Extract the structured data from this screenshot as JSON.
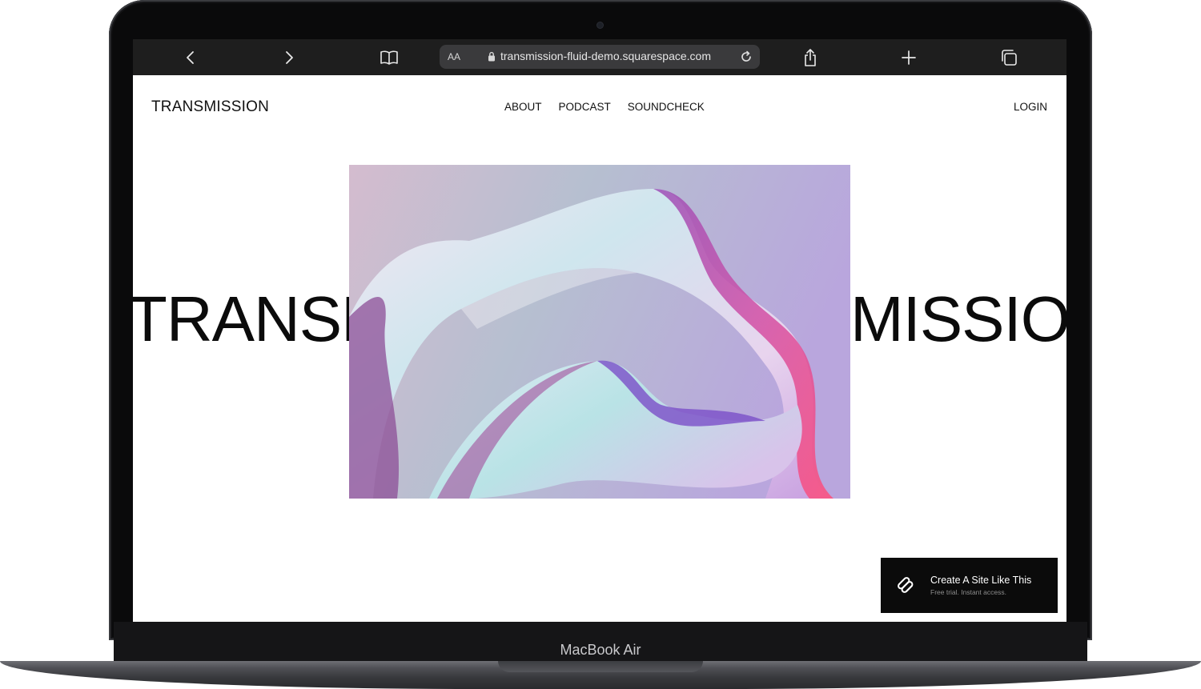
{
  "device": {
    "label": "MacBook Air"
  },
  "browser": {
    "text_size_label": "AA",
    "url": "transmission-fluid-demo.squarespace.com"
  },
  "site": {
    "logo": "TRANSMISSION",
    "nav": [
      "ABOUT",
      "PODCAST",
      "SOUNDCHECK"
    ],
    "login": "LOGIN",
    "hero_text_left": "TRANSM",
    "hero_text_right": "SMISSIO"
  },
  "cta": {
    "title": "Create A Site Like This",
    "subtitle": "Free trial. Instant access."
  },
  "colors": {
    "toolbar_bg": "#1e1e1e",
    "cta_bg": "#0b0b0b",
    "text": "#111111"
  },
  "icons": [
    "back-icon",
    "forward-icon",
    "bookmarks-icon",
    "lock-icon",
    "reload-icon",
    "share-icon",
    "new-tab-icon",
    "tabs-icon",
    "squarespace-logo-icon"
  ]
}
